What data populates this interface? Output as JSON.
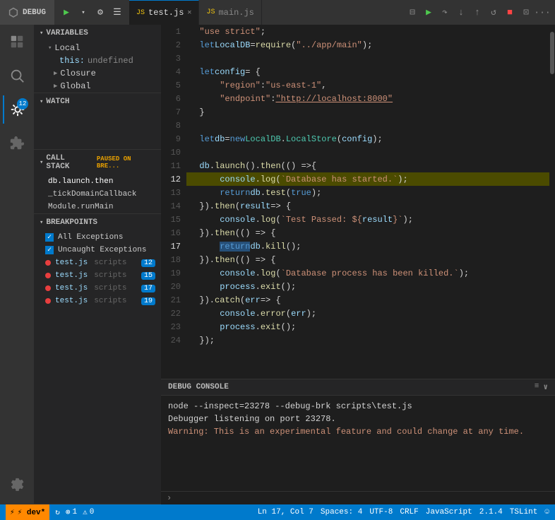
{
  "topbar": {
    "debug_label": "DEBUG",
    "tab1_label": "test.js",
    "tab2_label": "main.js",
    "tab1_icon": "JS",
    "tab2_icon": "JS"
  },
  "debug_controls": {
    "play": "▶",
    "step_over": "↷",
    "step_into": "↓",
    "step_out": "↑",
    "restart": "↺",
    "stop": "■"
  },
  "sidebar": {
    "variables_header": "VARIABLES",
    "local_label": "Local",
    "this_label": "this:",
    "this_value": "undefined",
    "closure_label": "Closure",
    "global_label": "Global",
    "watch_header": "WATCH",
    "callstack_header": "CALL STACK",
    "callstack_paused": "PAUSED ON BRE...",
    "callstack_items": [
      "db.launch.then",
      "_tickDomainCallback",
      "Module.runMain"
    ],
    "breakpoints_header": "BREAKPOINTS",
    "bp_all_exceptions": "All Exceptions",
    "bp_uncaught_exceptions": "Uncaught Exceptions",
    "bp_items": [
      {
        "file": "test.js",
        "path": "scripts",
        "line": "12"
      },
      {
        "file": "test.js",
        "path": "scripts",
        "line": "15"
      },
      {
        "file": "test.js",
        "path": "scripts",
        "line": "17"
      },
      {
        "file": "test.js",
        "path": "scripts",
        "line": "19"
      }
    ]
  },
  "editor": {
    "filename": "test.js",
    "lines": [
      {
        "n": 1,
        "code": "  \"use strict\";"
      },
      {
        "n": 2,
        "code": "  let LocalDB = require(\"../app/main\");"
      },
      {
        "n": 3,
        "code": ""
      },
      {
        "n": 4,
        "code": "  let config = {"
      },
      {
        "n": 5,
        "code": "      \"region\": \"us-east-1\","
      },
      {
        "n": 6,
        "code": "      \"endpoint\": \"http://localhost:8000\""
      },
      {
        "n": 7,
        "code": "  }"
      },
      {
        "n": 8,
        "code": ""
      },
      {
        "n": 9,
        "code": "  let db = new LocalDB.LocalStore(config);"
      },
      {
        "n": 10,
        "code": ""
      },
      {
        "n": 11,
        "code": "  db.launch().then(() =>{"
      },
      {
        "n": 12,
        "code": "      console.log(`Database has started.`);"
      },
      {
        "n": 13,
        "code": "      return db.test(true);"
      },
      {
        "n": 14,
        "code": "  }).then(result => {"
      },
      {
        "n": 15,
        "code": "      console.log(`Test Passed: ${result}`);"
      },
      {
        "n": 16,
        "code": "  }).then(() => {"
      },
      {
        "n": 17,
        "code": "      return db.kill();"
      },
      {
        "n": 18,
        "code": "  }).then(() => {"
      },
      {
        "n": 19,
        "code": "      console.log(`Database process has been killed.`);"
      },
      {
        "n": 20,
        "code": "      process.exit();"
      },
      {
        "n": 21,
        "code": "  }).catch(err => {"
      },
      {
        "n": 22,
        "code": "      console.error(err);"
      },
      {
        "n": 23,
        "code": "      process.exit();"
      },
      {
        "n": 24,
        "code": "  });"
      }
    ]
  },
  "console": {
    "header": "DEBUG CONSOLE",
    "line1": "node --inspect=23278 --debug-brk scripts\\test.js",
    "line2": "Debugger listening on port 23278.",
    "line3": "Warning: This is an experimental feature and could change at any time."
  },
  "statusbar": {
    "dev": "⚡ dev*",
    "sync": "↻",
    "errors": "⊗ 1",
    "warnings": "⚠ 0",
    "line_col": "Ln 17, Col 7",
    "spaces": "Spaces: 4",
    "encoding": "UTF-8",
    "eol": "CRLF",
    "language": "JavaScript",
    "version": "2.1.4",
    "linter": "TSLint",
    "smiley": "☺"
  }
}
